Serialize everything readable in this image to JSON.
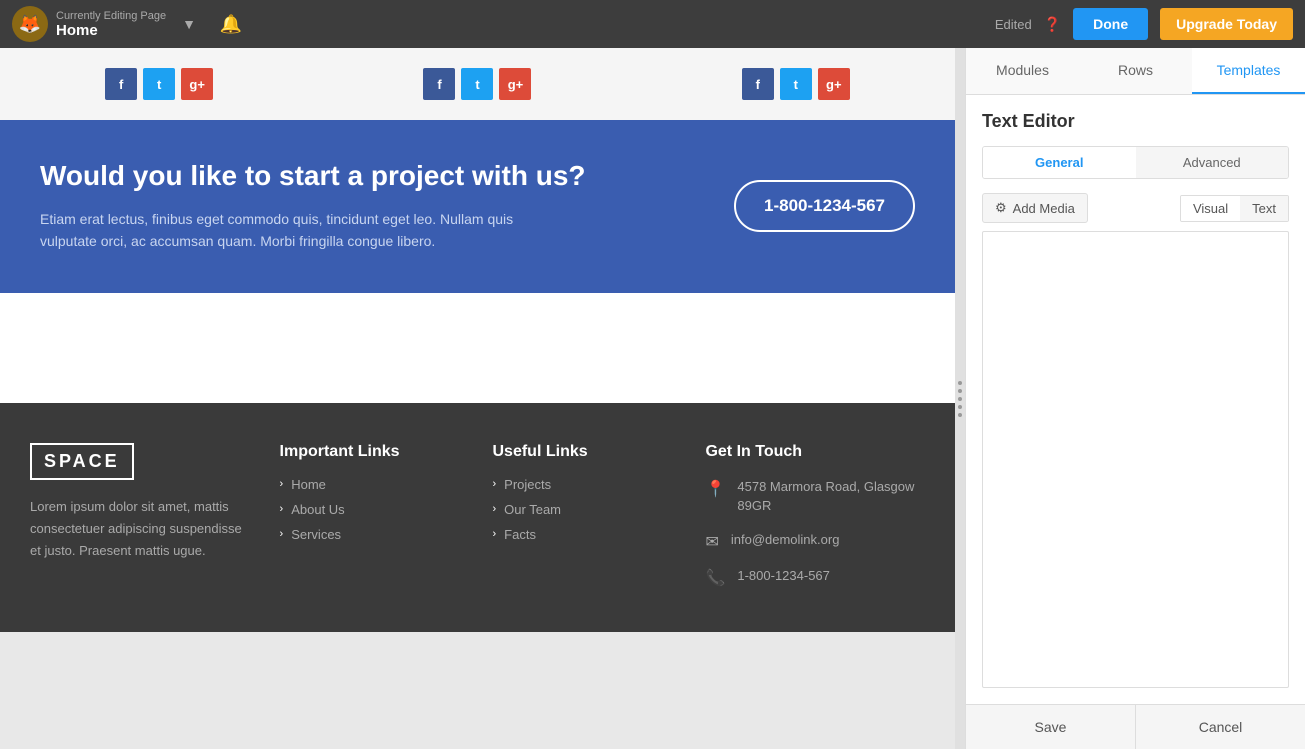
{
  "topbar": {
    "editing_label": "Currently Editing Page",
    "page_name": "Home",
    "edited_label": "Edited",
    "done_label": "Done",
    "upgrade_label": "Upgrade Today"
  },
  "social_groups": [
    {
      "buttons": [
        "f",
        "t",
        "g+"
      ]
    },
    {
      "buttons": [
        "f",
        "t",
        "g+"
      ]
    },
    {
      "buttons": [
        "f",
        "t",
        "g+"
      ]
    }
  ],
  "cta": {
    "heading": "Would you like to start a project with us?",
    "body": "Etiam erat lectus, finibus eget commodo quis, tincidunt eget leo. Nullam quis vulputate orci, ac accumsan quam. Morbi fringilla congue libero.",
    "phone": "1-800-1234-567"
  },
  "footer": {
    "logo": "SPACE",
    "tagline": "Lorem ipsum dolor sit amet, mattis consectetuer adipiscing suspendisse et justo. Praesent mattis ugue.",
    "important_links_title": "Important Links",
    "important_links": [
      {
        "label": "Home"
      },
      {
        "label": "About Us"
      },
      {
        "label": "Services"
      }
    ],
    "useful_links_title": "Useful Links",
    "useful_links": [
      {
        "label": "Projects"
      },
      {
        "label": "Our Team"
      },
      {
        "label": "Facts"
      }
    ],
    "contact_title": "Get In Touch",
    "address": "4578 Marmora Road,\nGlasgow 89GR",
    "email": "info@demolink.org",
    "phone": "1-800-1234-567"
  },
  "sidebar": {
    "tab_modules": "Modules",
    "tab_rows": "Rows",
    "tab_templates": "Templates",
    "editor_title": "Text Editor",
    "subtab_general": "General",
    "subtab_advanced": "Advanced",
    "add_media_label": "Add Media",
    "visual_label": "Visual",
    "text_label": "Text",
    "save_label": "Save",
    "cancel_label": "Cancel"
  }
}
